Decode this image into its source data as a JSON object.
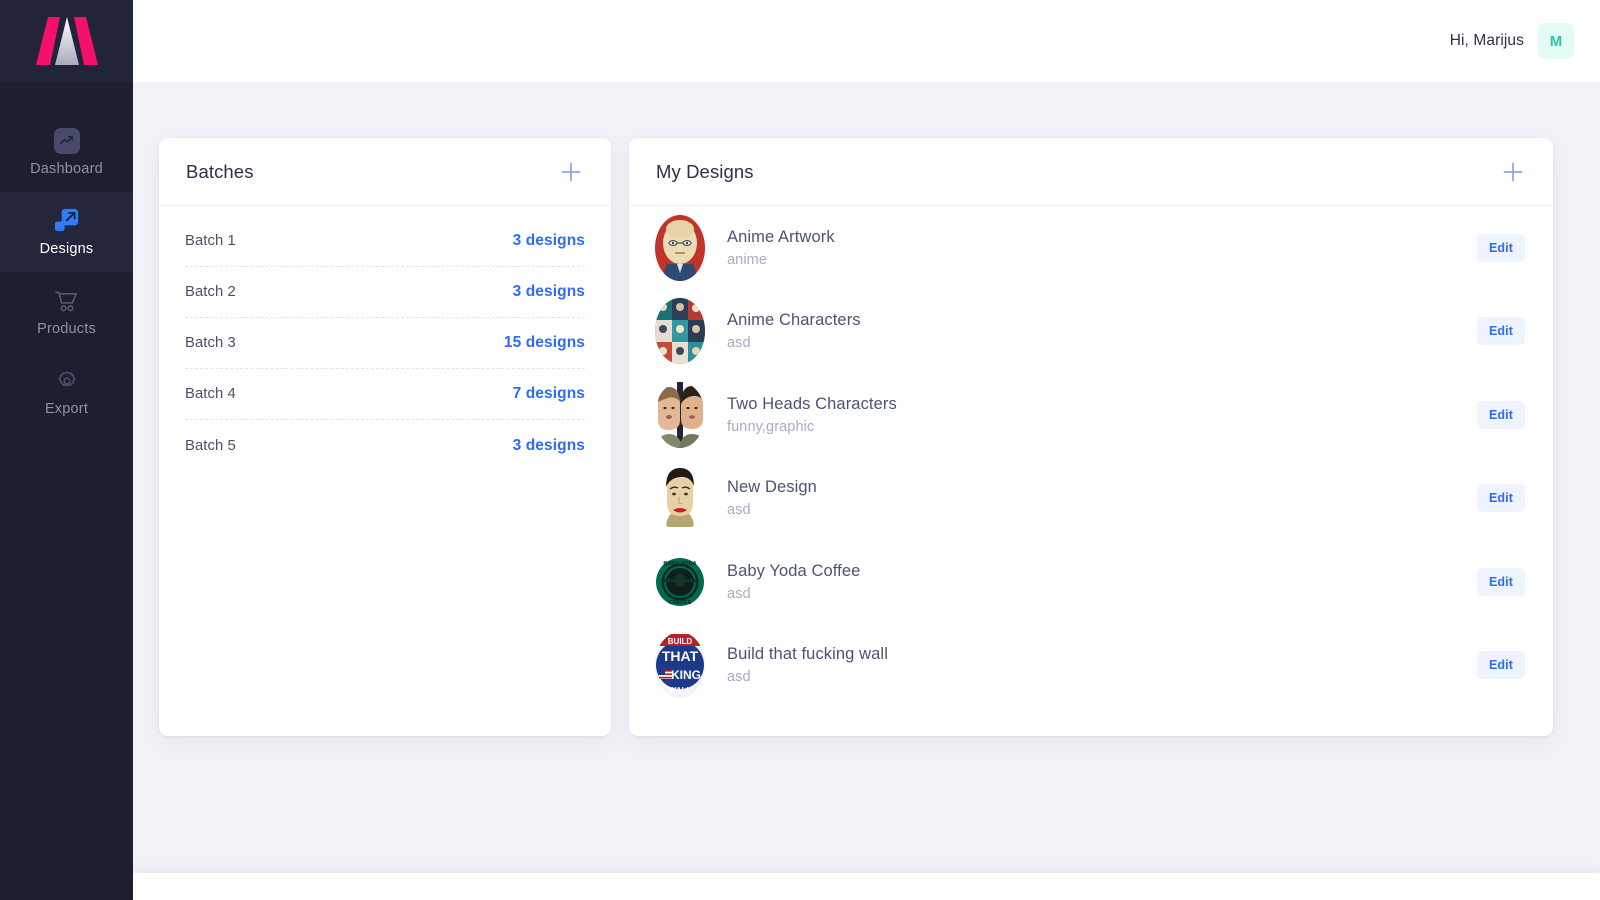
{
  "brand": {
    "logo_name": "mugl-logo",
    "accent": "#f5116b"
  },
  "sidebar": {
    "items": [
      {
        "label": "Dashboard",
        "icon": "trending-up-icon",
        "active": false
      },
      {
        "label": "Designs",
        "icon": "expand-arrow-icon",
        "active": true
      },
      {
        "label": "Products",
        "icon": "shopping-cart-icon",
        "active": false
      },
      {
        "label": "Export",
        "icon": "gear-icon",
        "active": false
      }
    ]
  },
  "topbar": {
    "greeting": "Hi, Marijus",
    "avatar_initial": "M",
    "avatar_color": "#2ac4a8"
  },
  "batches_panel": {
    "title": "Batches",
    "add_icon": "plus-icon",
    "rows": [
      {
        "name": "Batch 1",
        "count": "3 designs"
      },
      {
        "name": "Batch 2",
        "count": "3 designs"
      },
      {
        "name": "Batch 3",
        "count": "15 designs"
      },
      {
        "name": "Batch 4",
        "count": "7 designs"
      },
      {
        "name": "Batch 5",
        "count": "3 designs"
      }
    ]
  },
  "designs_panel": {
    "title": "My Designs",
    "add_icon": "plus-icon",
    "edit_label": "Edit",
    "rows": [
      {
        "title": "Anime Artwork",
        "tag": "anime",
        "thumb": "one-punch-man-thumb"
      },
      {
        "title": "Anime Characters",
        "tag": "asd",
        "thumb": "anime-grid-thumb"
      },
      {
        "title": "Two Heads Characters",
        "tag": "funny,graphic",
        "thumb": "two-heads-thumb"
      },
      {
        "title": "New Design",
        "tag": "asd",
        "thumb": "face-thumb"
      },
      {
        "title": "Baby Yoda Coffee",
        "tag": "asd",
        "thumb": "baby-yoda-coffee-thumb"
      },
      {
        "title": "Build that fucking wall",
        "tag": "asd",
        "thumb": "wall-badge-thumb"
      }
    ]
  },
  "colors": {
    "sidebar_bg": "#1d1f31",
    "page_bg": "#f1f2f7",
    "link_blue": "#2f6bf3",
    "title_text": "#2d3047"
  }
}
